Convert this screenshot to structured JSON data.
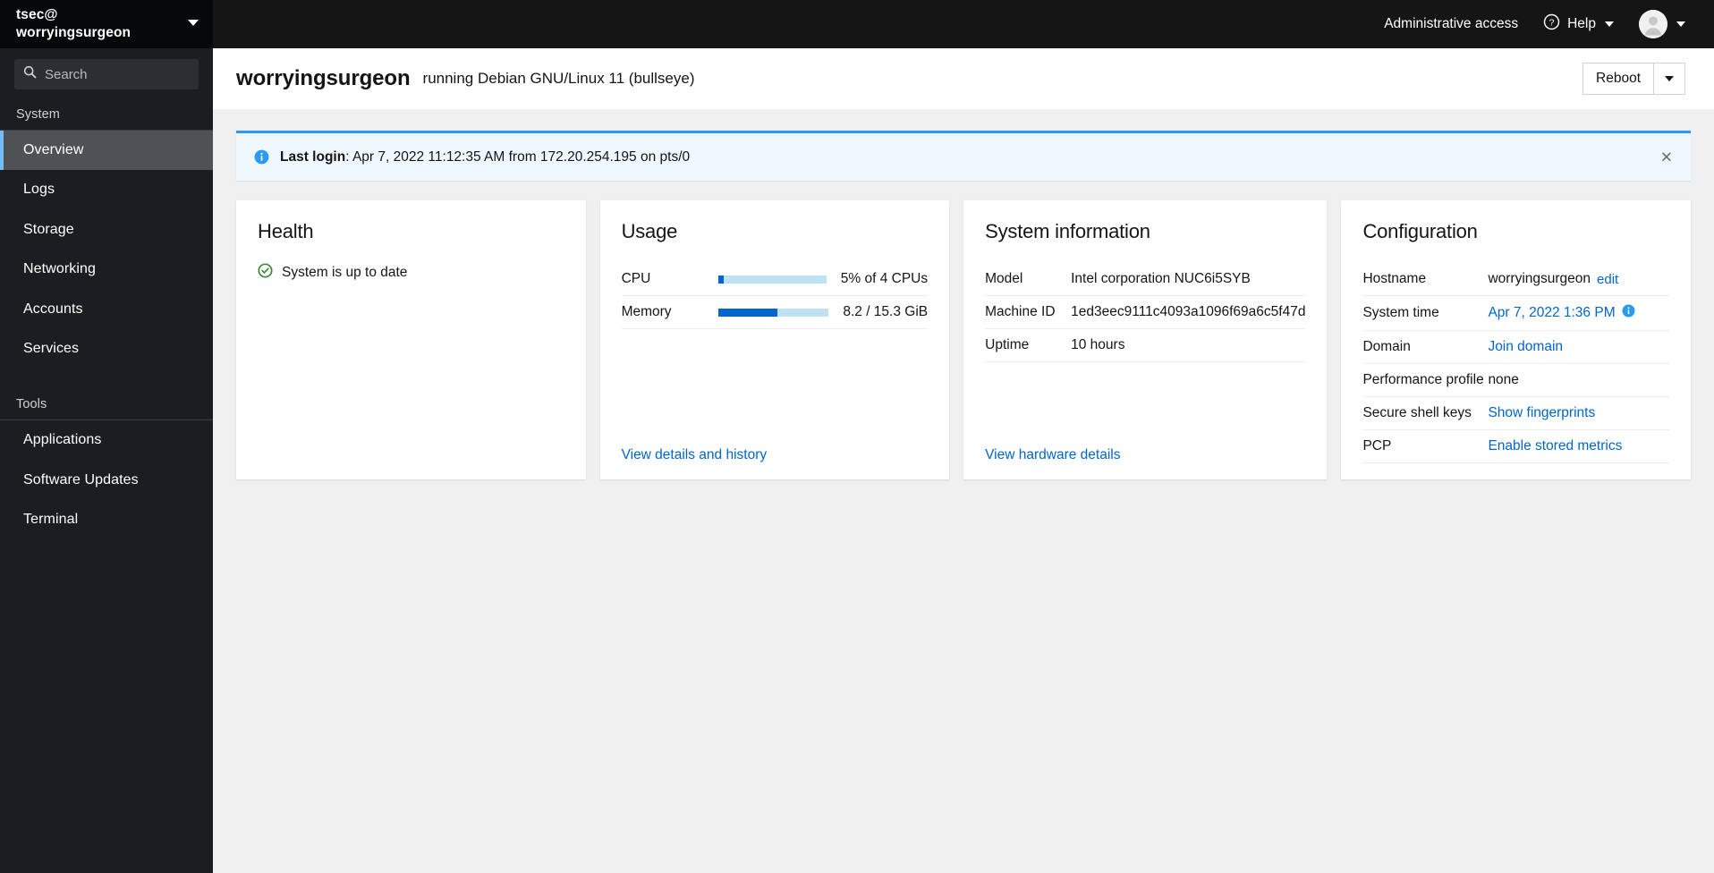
{
  "sidebar": {
    "user_line1": "tsec@",
    "user_line2": "worryingsurgeon",
    "host_caret_icon": "chevron-down-icon",
    "search": {
      "placeholder": "Search",
      "value": "",
      "icon": "search-icon"
    },
    "groups": [
      {
        "label": "System",
        "items": [
          {
            "label": "Overview",
            "active": true
          },
          {
            "label": "Logs",
            "active": false
          },
          {
            "label": "Storage",
            "active": false
          },
          {
            "label": "Networking",
            "active": false
          },
          {
            "label": "Accounts",
            "active": false
          },
          {
            "label": "Services",
            "active": false
          }
        ]
      },
      {
        "label": "Tools",
        "items": [
          {
            "label": "Applications",
            "active": false
          },
          {
            "label": "Software Updates",
            "active": false
          },
          {
            "label": "Terminal",
            "active": false
          }
        ]
      }
    ]
  },
  "topbar": {
    "admin_access": "Administrative access",
    "help_label": "Help",
    "help_icon": "question-circle-icon",
    "help_caret_icon": "chevron-down-icon",
    "avatar_icon": "user-avatar-icon",
    "user_caret_icon": "chevron-down-icon"
  },
  "page_header": {
    "title": "worryingsurgeon",
    "subtitle": "running Debian GNU/Linux 11 (bullseye)",
    "reboot_label": "Reboot",
    "reboot_caret_icon": "chevron-down-icon"
  },
  "alert": {
    "icon": "info-circle-icon",
    "label": "Last login",
    "separator": ": ",
    "message": "Apr 7, 2022 11:12:35 AM from 172.20.254.195 on pts/0",
    "close_icon": "close-icon",
    "close_label": "✕",
    "accent_color": "#2b9af3",
    "background_color": "#f0f8ff"
  },
  "cards": {
    "health": {
      "title": "Health",
      "status_icon": "check-circle-icon",
      "status_text": "System is up to date",
      "status_color": "#3e8635"
    },
    "usage": {
      "title": "Usage",
      "rows": [
        {
          "label": "CPU",
          "value": "5% of 4 CPUs",
          "percent": 5
        },
        {
          "label": "Memory",
          "value": "8.2 / 15.3 GiB",
          "percent": 54
        }
      ],
      "footer_link": "View details and history"
    },
    "system_information": {
      "title": "System information",
      "rows": [
        {
          "key": "Model",
          "value": "Intel corporation NUC6i5SYB"
        },
        {
          "key": "Machine ID",
          "value": "1ed3eec9111c4093a1096f69a6c5f47d"
        },
        {
          "key": "Uptime",
          "value": "10 hours"
        }
      ],
      "footer_link": "View hardware details"
    },
    "configuration": {
      "title": "Configuration",
      "rows": [
        {
          "key": "Hostname",
          "value": "worryingsurgeon",
          "edit_label": "edit"
        },
        {
          "key": "System time",
          "link": "Apr 7, 2022 1:36 PM",
          "info_icon": "info-circle-icon"
        },
        {
          "key": "Domain",
          "link": "Join domain"
        },
        {
          "key": "Performance profile",
          "value": "none"
        },
        {
          "key": "Secure shell keys",
          "link": "Show fingerprints"
        },
        {
          "key": "PCP",
          "link": "Enable stored metrics"
        }
      ]
    }
  },
  "colors": {
    "accent_blue": "#06c",
    "link_blue": "#06c",
    "sidebar_bg": "#1b1d21",
    "sidebar_header_bg": "#06080a",
    "topbar_bg": "#151515",
    "active_nav": "#4f5255",
    "active_border": "#73bcf7",
    "success_green": "#3e8635",
    "progress_track": "#bee1f4"
  }
}
